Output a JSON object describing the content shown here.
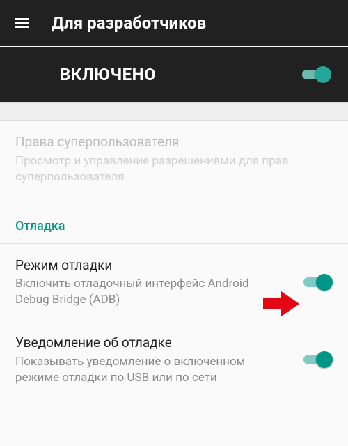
{
  "appbar": {
    "title": "Для разработчиков"
  },
  "master_toggle": {
    "label": "ВКЛЮЧЕНО",
    "on": true
  },
  "items": {
    "superuser": {
      "title": "Права суперпользователя",
      "sub": "Просмотр и управление разрешениями для прав суперпользователя",
      "enabled": false
    },
    "section_debug": "Отладка",
    "debug_mode": {
      "title": "Режим отладки",
      "sub": "Включить отладочный интерфейс Android Debug Bridge (ADB)",
      "on": true
    },
    "debug_notify": {
      "title": "Уведомление об отладке",
      "sub": "Показывать уведомление о включенном режиме отладки по USB или по сети",
      "on": true
    }
  },
  "colors": {
    "accent": "#009688",
    "appbar": "#212121",
    "arrow": "#E30613"
  }
}
